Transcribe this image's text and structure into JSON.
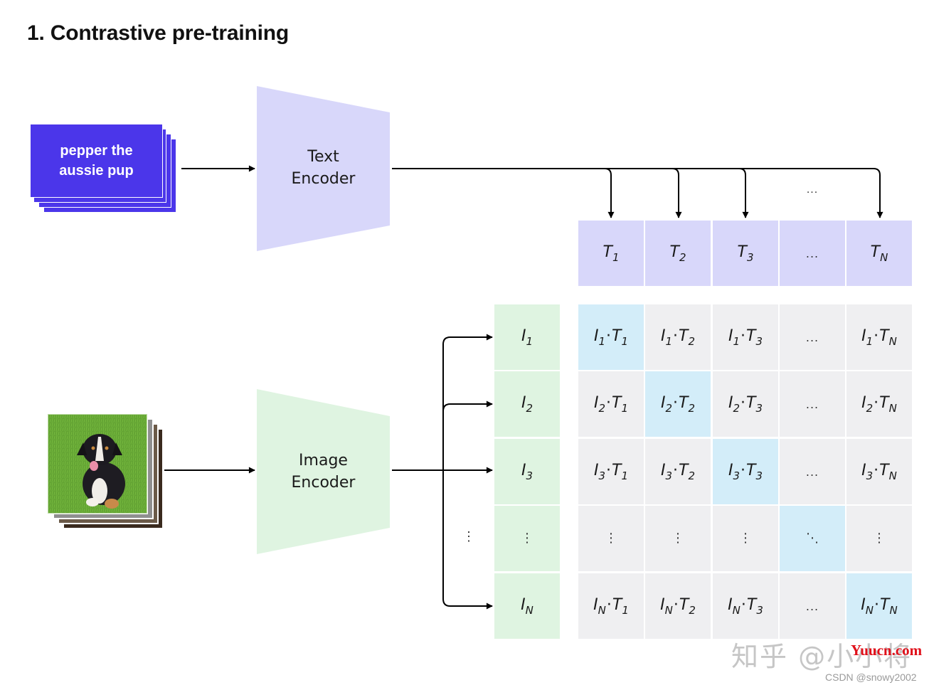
{
  "title": "1. Contrastive pre-training",
  "text_input": {
    "line1": "pepper the",
    "line2": "aussie pup"
  },
  "image_input": {
    "icon": "dog-photo-stack",
    "description": "photo of a puppy sitting on grass"
  },
  "text_encoder": {
    "line1": "Text",
    "line2": "Encoder"
  },
  "image_encoder": {
    "line1": "Image",
    "line2": "Encoder"
  },
  "text_arrows_ellipsis": "...",
  "text_embeddings": [
    {
      "base": "T",
      "sub": "1"
    },
    {
      "base": "T",
      "sub": "2"
    },
    {
      "base": "T",
      "sub": "3"
    },
    {
      "base": "...",
      "sub": ""
    },
    {
      "base": "T",
      "sub": "N"
    }
  ],
  "image_embeddings": [
    {
      "base": "I",
      "sub": "1"
    },
    {
      "base": "I",
      "sub": "2"
    },
    {
      "base": "I",
      "sub": "3"
    },
    {
      "base": "⋮",
      "sub": ""
    },
    {
      "base": "I",
      "sub": "N"
    }
  ],
  "left_vertical_ellipsis": "⋮",
  "matrix": {
    "row_subs": [
      "1",
      "2",
      "3",
      "",
      "N"
    ],
    "col_subs": [
      "1",
      "2",
      "3",
      "",
      "N"
    ],
    "horizontal_ellipsis": "...",
    "vertical_ellipsis": "⋮",
    "diagonal_ellipsis": "⋱",
    "diagonal_highlight": true
  },
  "colors": {
    "text_card": "#4b36ea",
    "text_encoder": "#d8d7fa",
    "image_encoder": "#dff4e1",
    "text_embedding": "#d8d7fa",
    "image_embedding": "#dff4e1",
    "matrix_cell": "#efeff1",
    "matrix_diagonal": "#d3edf9"
  },
  "watermarks": {
    "zhihu": "知乎 @小小将",
    "yuucn": "Yuucn.com",
    "csdn": "CSDN @snowy2002"
  }
}
